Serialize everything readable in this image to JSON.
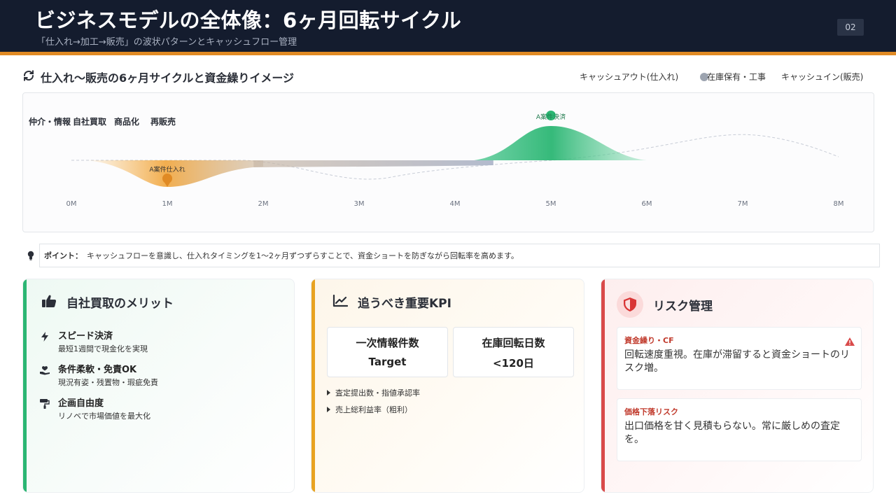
{
  "header": {
    "title": "ビジネスモデルの全体像：6ヶ月回転サイクル",
    "subtitle": "「仕入れ→加工→販売」の波状パターンとキャッシュフロー管理",
    "page_number": "02"
  },
  "section": {
    "title": "仕入れ〜販売の6ヶ月サイクルと資金繰りイメージ",
    "icon": "sync-icon",
    "legend": [
      "キャッシュアウト(仕入れ)",
      "在庫保有・工事",
      "キャッシュイン(販売)"
    ]
  },
  "chart_data": {
    "type": "area",
    "phases": [
      "仲介・情報",
      "自社買取",
      "商品化",
      "再販売"
    ],
    "x_ticks": [
      "0M",
      "1M",
      "2M",
      "3M",
      "4M",
      "5M",
      "6M",
      "7M",
      "8M"
    ],
    "annotations": [
      {
        "label": "A案件仕入れ",
        "x": 1,
        "color": "#e08a24"
      },
      {
        "label": "A案件決済",
        "x": 5,
        "color": "#2bb673"
      }
    ],
    "series": [
      {
        "name": "キャッシュアウト(仕入れ)",
        "color": "#f0a030",
        "x": [
          0,
          0.5,
          1,
          1.5,
          2
        ],
        "y": [
          0,
          -0.4,
          -1,
          -0.4,
          0
        ]
      },
      {
        "name": "在庫保有・工事",
        "color": "#b7bfd1",
        "x": [
          2,
          3,
          4.3
        ],
        "y": [
          -0.25,
          -0.25,
          -0.2
        ]
      },
      {
        "name": "キャッシュイン(販売)",
        "color": "#2bb673",
        "x": [
          4.3,
          4.7,
          5,
          5.4,
          6
        ],
        "y": [
          0,
          1.2,
          1.5,
          1.2,
          0
        ]
      }
    ]
  },
  "point": {
    "label": "ポイント：",
    "text": "キャッシュフローを意識し、仕入れタイミングを1〜2ヶ月ずつずらすことで、資金ショートを防ぎながら回転率を高めます。"
  },
  "merit": {
    "title": "自社買取のメリット",
    "items": [
      {
        "title": "スピード決済",
        "desc": "最短1週間で現金化を実現",
        "icon": "bolt-icon"
      },
      {
        "title": "条件柔軟・免責OK",
        "desc": "現況有姿・残置物・瑕疵免責",
        "icon": "handshake-icon"
      },
      {
        "title": "企画自由度",
        "desc": "リノベで市場価値を最大化",
        "icon": "paint-roller-icon"
      }
    ]
  },
  "kpi": {
    "title": "追うべき重要KPI",
    "boxes": [
      {
        "label": "一次情報件数",
        "value": "Target"
      },
      {
        "label": "在庫回転日数",
        "value": "<120日"
      }
    ],
    "list": [
      "査定提出数・指値承認率",
      "売上総利益率（粗利）"
    ]
  },
  "risk": {
    "title": "リスク管理",
    "items": [
      {
        "title": "資金繰り・CF",
        "desc": "回転速度重視。在庫が滞留すると資金ショートのリスク増。"
      },
      {
        "title": "価格下落リスク",
        "desc": "出口価格を甘く見積もらない。常に厳しめの査定を。"
      }
    ]
  },
  "colors": {
    "header_bg": "#141c2e",
    "accent_orange": "#e08a24",
    "green": "#2bb673",
    "amber": "#e8a321",
    "red": "#d94a4a"
  }
}
